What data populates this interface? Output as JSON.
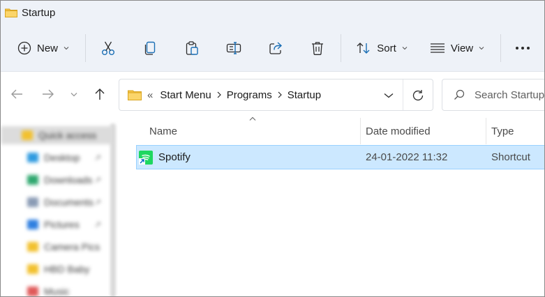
{
  "window": {
    "title": "Startup",
    "title_icon": "folder-icon"
  },
  "toolbar": {
    "new_label": "New",
    "sort_label": "Sort",
    "view_label": "View",
    "icons": [
      "new-plus-icon",
      "cut-icon",
      "copy-icon",
      "paste-icon",
      "rename-icon",
      "share-icon",
      "delete-icon",
      "sort-icon",
      "view-icon",
      "more-icon"
    ]
  },
  "address": {
    "overflow": "«",
    "crumbs": [
      "Start Menu",
      "Programs",
      "Startup"
    ]
  },
  "search": {
    "placeholder": "Search Startup"
  },
  "nav_pane": {
    "items": [
      {
        "label": "Quick access",
        "color": "#f2c12e"
      },
      {
        "label": "Desktop",
        "color": "#2f9be0"
      },
      {
        "label": "Downloads",
        "color": "#2fa86f"
      },
      {
        "label": "Documents",
        "color": "#8a9bb5"
      },
      {
        "label": "Pictures",
        "color": "#2f7fe0"
      },
      {
        "label": "Camera Pics",
        "color": "#f2c12e"
      },
      {
        "label": "HBD Baby",
        "color": "#f2c12e"
      },
      {
        "label": "Music",
        "color": "#e05a5a"
      }
    ]
  },
  "columns": {
    "name": "Name",
    "date": "Date modified",
    "type": "Type"
  },
  "files": [
    {
      "name": "Spotify",
      "date": "24-01-2022 11:32",
      "type": "Shortcut"
    }
  ],
  "colors": {
    "selection_bg": "#cce8ff",
    "selection_border": "#99d1ff",
    "accent": "#0067c0",
    "folder": "#f4c245",
    "spotify": "#1ed760"
  }
}
